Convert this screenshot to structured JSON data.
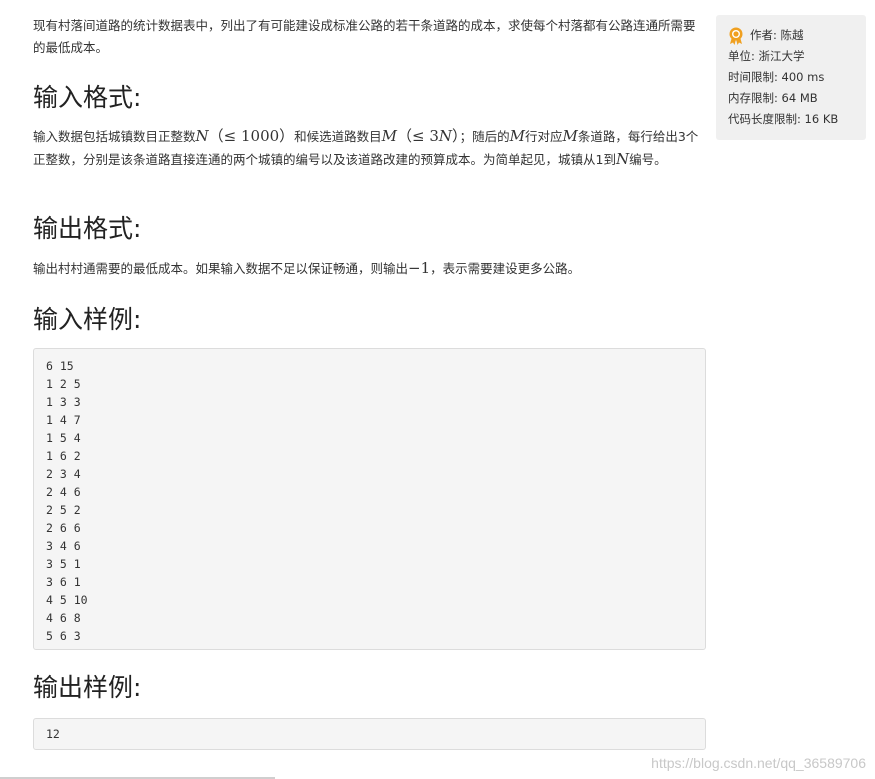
{
  "intro": "现有村落间道路的统计数据表中，列出了有可能建设成标准公路的若干条道路的成本，求使每个村落都有公路连通所需要的最低成本。",
  "input_format": {
    "title": "输入格式:",
    "p1": "输入数据包括城镇数目正整数",
    "m1": "N",
    "m1b": "（≤ 1000）",
    "p2": "和候选道路数目",
    "m2": "M",
    "m2b": "（≤ 3",
    "m2c": "N",
    "m2d": "）",
    "p3": "；随后的",
    "m3": "M",
    "p4": "行对应",
    "m4": "M",
    "p5": "条道路，每行给出3个正整数，分别是该条道路直接连通的两个城镇的编号以及该道路改建的预算成本。为简单起见，城镇从1到",
    "m5": "N",
    "p6": "编号。"
  },
  "output_format": {
    "title": "输出格式:",
    "p1": "输出村村通需要的最低成本。如果输入数据不足以保证畅通，则输出",
    "m1": "−1",
    "p2": "，表示需要建设更多公路。"
  },
  "sample_input": {
    "title": "输入样例:",
    "lines": [
      "6 15",
      "1 2 5",
      "1 3 3",
      "1 4 7",
      "1 5 4",
      "1 6 2",
      "2 3 4",
      "2 4 6",
      "2 5 2",
      "2 6 6",
      "3 4 6",
      "3 5 1",
      "3 6 1",
      "4 5 10",
      "4 6 8",
      "5 6 3"
    ]
  },
  "sample_output": {
    "title": "输出样例:",
    "value": "12"
  },
  "sidebar": {
    "author": "作者: 陈越",
    "unit": "单位: 浙江大学",
    "time_limit": "时间限制: 400 ms",
    "memory_limit": "内存限制: 64 MB",
    "code_limit": "代码长度限制: 16 KB",
    "icon": "medal-icon",
    "icon_color": "#f0a020"
  },
  "watermark": "https://blog.csdn.net/qq_36589706"
}
